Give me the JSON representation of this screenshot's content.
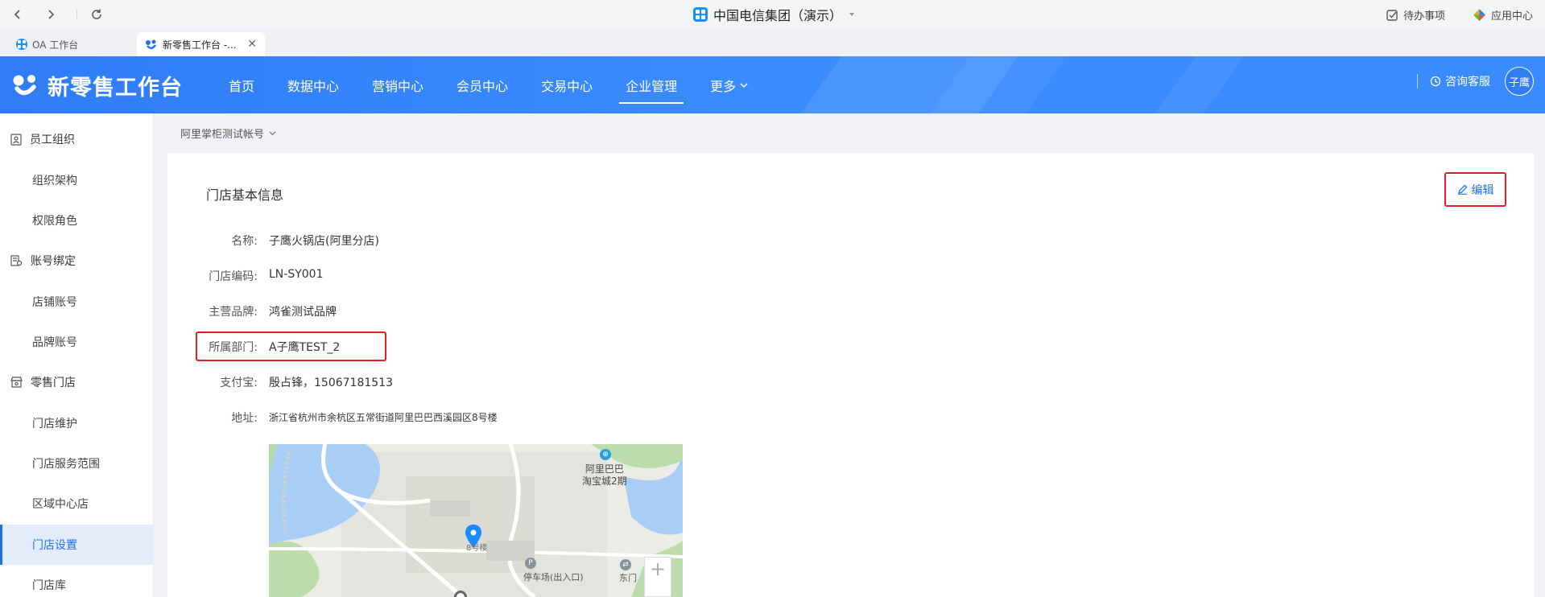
{
  "browser": {
    "window_title": "中国电信集团（演示）",
    "todo_label": "待办事项",
    "apps_label": "应用中心",
    "tabs": [
      {
        "label": "OA 工作台"
      },
      {
        "label": "新零售工作台 -..."
      }
    ]
  },
  "header": {
    "logo_text": "新零售工作台",
    "menu": [
      {
        "label": "首页"
      },
      {
        "label": "数据中心"
      },
      {
        "label": "营销中心"
      },
      {
        "label": "会员中心"
      },
      {
        "label": "交易中心"
      },
      {
        "label": "企业管理"
      },
      {
        "label": "更多"
      }
    ],
    "active_menu": "企业管理",
    "consult_label": "咨询客服",
    "user_name": "子鹰",
    "accent_color": "#2f7cf6"
  },
  "sidebar": {
    "groups": [
      {
        "label": "员工组织",
        "icon": "person-card-icon"
      },
      {
        "label": "账号绑定",
        "icon": "account-bind-icon"
      },
      {
        "label": "零售门店",
        "icon": "store-icon"
      }
    ],
    "items": [
      {
        "label": "组织架构"
      },
      {
        "label": "权限角色"
      },
      {
        "label": "店铺账号"
      },
      {
        "label": "品牌账号"
      },
      {
        "label": "门店维护"
      },
      {
        "label": "门店服务范围"
      },
      {
        "label": "区域中心店"
      },
      {
        "label": "门店设置"
      },
      {
        "label": "门店库"
      }
    ],
    "active_item": "门店设置"
  },
  "content": {
    "account_switch": "阿里掌柜测试帐号",
    "card_title": "门店基本信息",
    "edit_label": "编辑",
    "fields": [
      {
        "label": "名称:",
        "value": "子鹰火锅店(阿里分店)"
      },
      {
        "label": "门店编码:",
        "value": "LN-SY001"
      },
      {
        "label": "主营品牌:",
        "value": "鸿雀测试品牌"
      },
      {
        "label": "所属部门:",
        "value": "A子鹰TEST_2"
      },
      {
        "label": "支付宝:",
        "value": "殷占锋，15067181513"
      },
      {
        "label": "地址:",
        "value": "浙江省杭州市余杭区五常街道阿里巴巴西溪园区8号楼"
      }
    ],
    "map": {
      "poi_1": "阿里巴巴",
      "poi_1b": "淘宝城2期",
      "marker_label": "8号楼",
      "parking_label": "停车场(出入口)",
      "east_gate_label": "东门",
      "zoom_in": "+"
    }
  }
}
